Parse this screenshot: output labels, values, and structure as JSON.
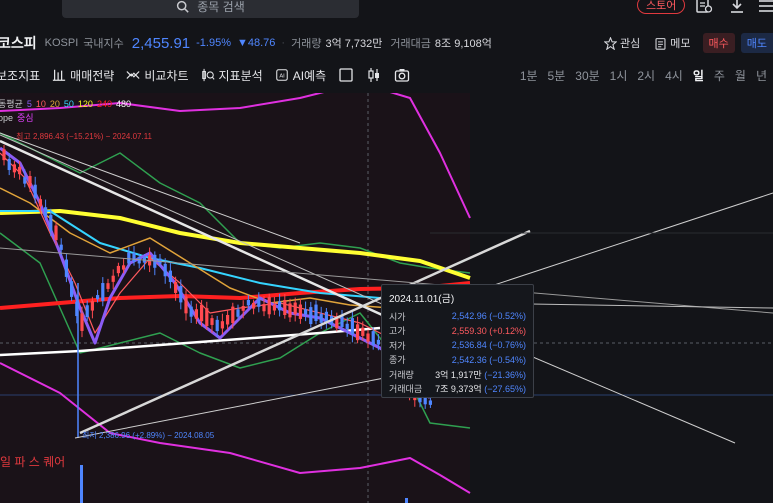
{
  "topbar": {
    "search_placeholder": "종목 검색",
    "store_label": "스토어"
  },
  "ticker": {
    "name": "코스피",
    "code": "KOSPI",
    "market": "국내지수",
    "price": "2,455.91",
    "change_pct": "-1.95%",
    "change_amt": "▼48.76",
    "volume_label": "거래량",
    "volume_value": "3억 7,732만",
    "amount_label": "거래대금",
    "amount_value": "8조 9,108억"
  },
  "right_tools": {
    "favorite": "관심",
    "memo": "메모",
    "buy": "매수",
    "sell": "매도"
  },
  "toolbar": {
    "aux": "보조지표",
    "strategy": "매매전략",
    "compare": "비교차트",
    "indicator": "지표분석",
    "ai": "AI예측"
  },
  "periods": [
    "1분",
    "5분",
    "30분",
    "1시",
    "2시",
    "4시",
    "일",
    "주",
    "월",
    "년"
  ],
  "active_period": "일",
  "legend": {
    "ma_label": "동평균",
    "ma_values": [
      "5",
      "10",
      "20",
      "50",
      "120",
      "240",
      "480"
    ],
    "ma_colors": [
      "#8b5cf6",
      "#ff5a5f",
      "#e0a33a",
      "#35d4ff",
      "#f5f521",
      "#ff2020",
      "#ffffff"
    ],
    "envelope_label": "ope",
    "envelope_center": "중심"
  },
  "annotations": {
    "max_text": "최고 2,896.43 (−15.21%) − 2024.07.11",
    "min_text": "최저 2,386.96 (+2.89%) − 2024.08.05",
    "watermark": "일 파 스 퀘어"
  },
  "tooltip": {
    "date": "2024.11.01(금)",
    "rows": [
      {
        "label": "시가",
        "value": "2,542.96 (−0.52%)",
        "color": "blue"
      },
      {
        "label": "고가",
        "value": "2,559.30 (+0.12%)",
        "color": "red"
      },
      {
        "label": "저가",
        "value": "2,536.84 (−0.76%)",
        "color": "blue"
      },
      {
        "label": "종가",
        "value": "2,542.36 (−0.54%)",
        "color": "blue"
      },
      {
        "label": "거래량",
        "value_main": "3억 1,917만",
        "value_sub": "(−21.36%)",
        "color": "blue"
      },
      {
        "label": "거래대금",
        "value_main": "7조 9,373억",
        "value_sub": "(−27.65%)",
        "color": "blue"
      }
    ]
  },
  "colors": {
    "up": "#ff5a5f",
    "down": "#4f86ff",
    "background": "#131418"
  }
}
